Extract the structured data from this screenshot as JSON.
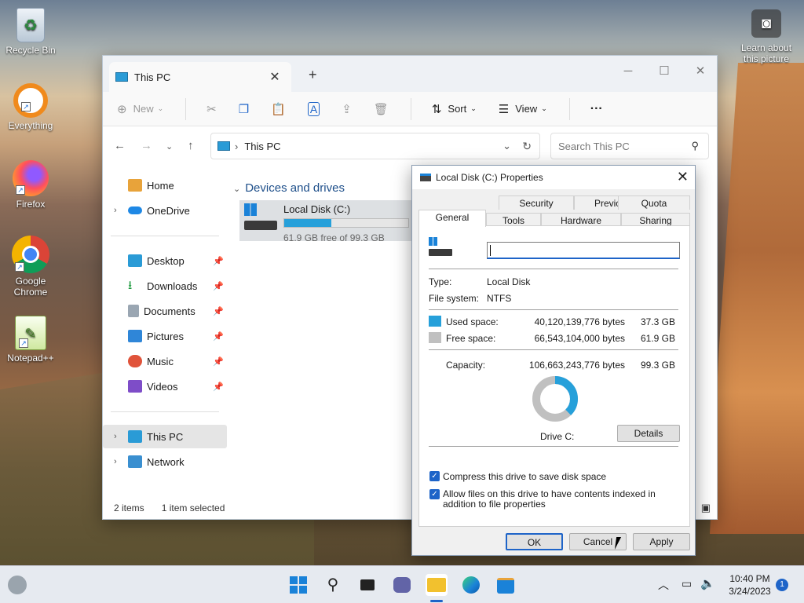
{
  "desktop": {
    "icons": [
      {
        "label": "Recycle Bin",
        "icon": "recycle-bin-icon"
      },
      {
        "label": "Everything",
        "icon": "everything-search-icon"
      },
      {
        "label": "Firefox",
        "icon": "firefox-icon"
      },
      {
        "label": "Google Chrome",
        "icon": "chrome-icon"
      },
      {
        "label": "Notepad++",
        "icon": "notepad-plus-plus-icon"
      }
    ],
    "learn": "Learn about this picture"
  },
  "explorer": {
    "tab_title": "This PC",
    "new_tab": "+",
    "toolbar": {
      "new": "New",
      "sort": "Sort",
      "view": "View",
      "more": "···"
    },
    "path": "This PC",
    "search_placeholder": "Search This PC",
    "sidebar": {
      "home": "Home",
      "onedrive": "OneDrive",
      "quick": [
        "Desktop",
        "Downloads",
        "Documents",
        "Pictures",
        "Music",
        "Videos"
      ],
      "thispc": "This PC",
      "network": "Network"
    },
    "group": "Devices and drives",
    "drive": {
      "name": "Local Disk (C:)",
      "free": "61.9 GB free of 99.3 GB",
      "used_fraction": 0.377
    },
    "status": {
      "items": "2 items",
      "selected": "1 item selected"
    }
  },
  "dialog": {
    "title": "Local Disk (C:) Properties",
    "tabs_row1": [
      "Security",
      "Previous Versions",
      "Quota"
    ],
    "tabs_row2": [
      "General",
      "Tools",
      "Hardware",
      "Sharing"
    ],
    "type_label": "Type:",
    "type_value": "Local Disk",
    "fs_label": "File system:",
    "fs_value": "NTFS",
    "used_label": "Used space:",
    "used_bytes": "40,120,139,776 bytes",
    "used_gb": "37.3 GB",
    "free_label": "Free space:",
    "free_bytes": "66,543,104,000 bytes",
    "free_gb": "61.9 GB",
    "cap_label": "Capacity:",
    "cap_bytes": "106,663,243,776 bytes",
    "cap_gb": "99.3 GB",
    "drive_label": "Drive C:",
    "details": "Details",
    "compress": "Compress this drive to save disk space",
    "index": "Allow files on this drive to have contents indexed in addition to file properties",
    "ok": "OK",
    "cancel": "Cancel",
    "apply": "Apply",
    "colors": {
      "used": "#26a0da",
      "free": "#c0c0c0"
    }
  },
  "taskbar": {
    "time": "10:40 PM",
    "date": "3/24/2023",
    "badge": "1"
  }
}
